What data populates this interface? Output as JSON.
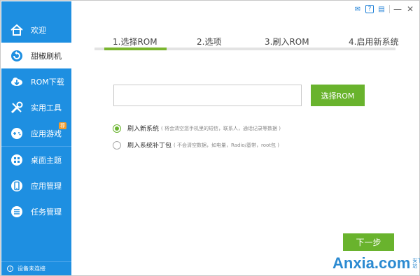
{
  "window_controls": {
    "chat": "✉",
    "help": "?",
    "skin": "▤",
    "minimize": "—",
    "close": "✕"
  },
  "sidebar": {
    "items": [
      {
        "label": "欢迎",
        "icon": "home-icon"
      },
      {
        "label": "甜椒刷机",
        "icon": "refresh-icon",
        "active": true
      },
      {
        "label": "ROM下载",
        "icon": "cloud-download-icon"
      },
      {
        "label": "实用工具",
        "icon": "tools-icon"
      },
      {
        "label": "应用游戏",
        "icon": "gamepad-icon",
        "badge": "荐"
      },
      {
        "label": "桌面主题",
        "icon": "grid-icon"
      },
      {
        "label": "应用管理",
        "icon": "phone-icon"
      },
      {
        "label": "任务管理",
        "icon": "list-icon"
      }
    ],
    "device_status": "设备未连接",
    "accent_color": "#1e8fe1"
  },
  "steps": {
    "items": [
      "1.选择ROM",
      "2.选项",
      "3.刷入ROM",
      "4.启用新系统"
    ],
    "current": 1,
    "progress_color": "#7ab52f"
  },
  "rom": {
    "path_value": "",
    "select_button": "选择ROM"
  },
  "options": [
    {
      "title": "刷入新系统",
      "note": "( 将会清空您手机里的短信，联系人，通话记录等数据 )",
      "checked": true
    },
    {
      "title": "刷入系统补丁包",
      "note": "( 不会清空数据，如电量，Radio/基带，root包 )",
      "checked": false
    }
  ],
  "next_button": "下一步",
  "watermark": {
    "text": "Anxia.com",
    "sub": "安下软件站"
  }
}
